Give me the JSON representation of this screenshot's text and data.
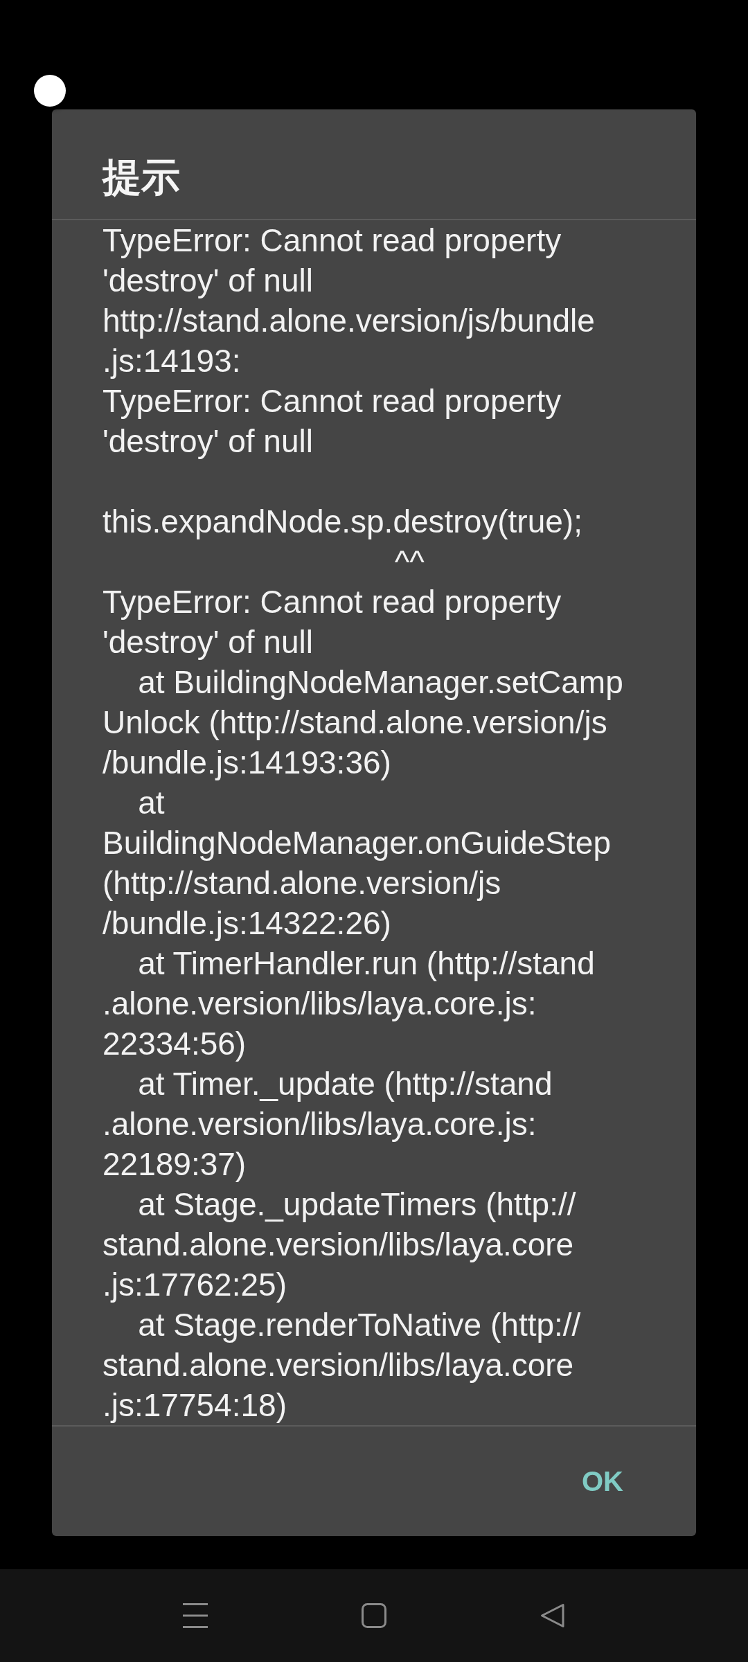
{
  "dialog": {
    "title": "提示",
    "message": [
      {
        "lines": [
          "TypeError: Cannot read property",
          "'destroy' of null",
          "http://stand.alone.version/js/bundle",
          ".js:14193:",
          "TypeError: Cannot read property",
          "'destroy' of null"
        ]
      },
      {
        "lines": [
          "this.expandNode.sp.destroy(true);",
          "                                 ^^",
          "TypeError: Cannot read property",
          "'destroy' of null",
          "    at BuildingNodeManager.setCamp",
          "Unlock (http://stand.alone.version/js",
          "/bundle.js:14193:36)",
          "    at",
          "BuildingNodeManager.onGuideStep",
          "(http://stand.alone.version/js",
          "/bundle.js:14322:26)",
          "    at TimerHandler.run (http://stand",
          ".alone.version/libs/laya.core.js:",
          "22334:56)",
          "    at Timer._update (http://stand",
          ".alone.version/libs/laya.core.js:",
          "22189:37)",
          "    at Stage._updateTimers (http://",
          "stand.alone.version/libs/laya.core",
          ".js:17762:25)",
          "    at Stage.renderToNative (http://",
          "stand.alone.version/libs/laya.core",
          ".js:17754:18)"
        ]
      }
    ],
    "buttons": [
      {
        "label": "OK"
      }
    ]
  },
  "navigation_bar": {
    "buttons": [
      {
        "kind": "menu"
      },
      {
        "kind": "home"
      },
      {
        "kind": "back"
      }
    ]
  }
}
